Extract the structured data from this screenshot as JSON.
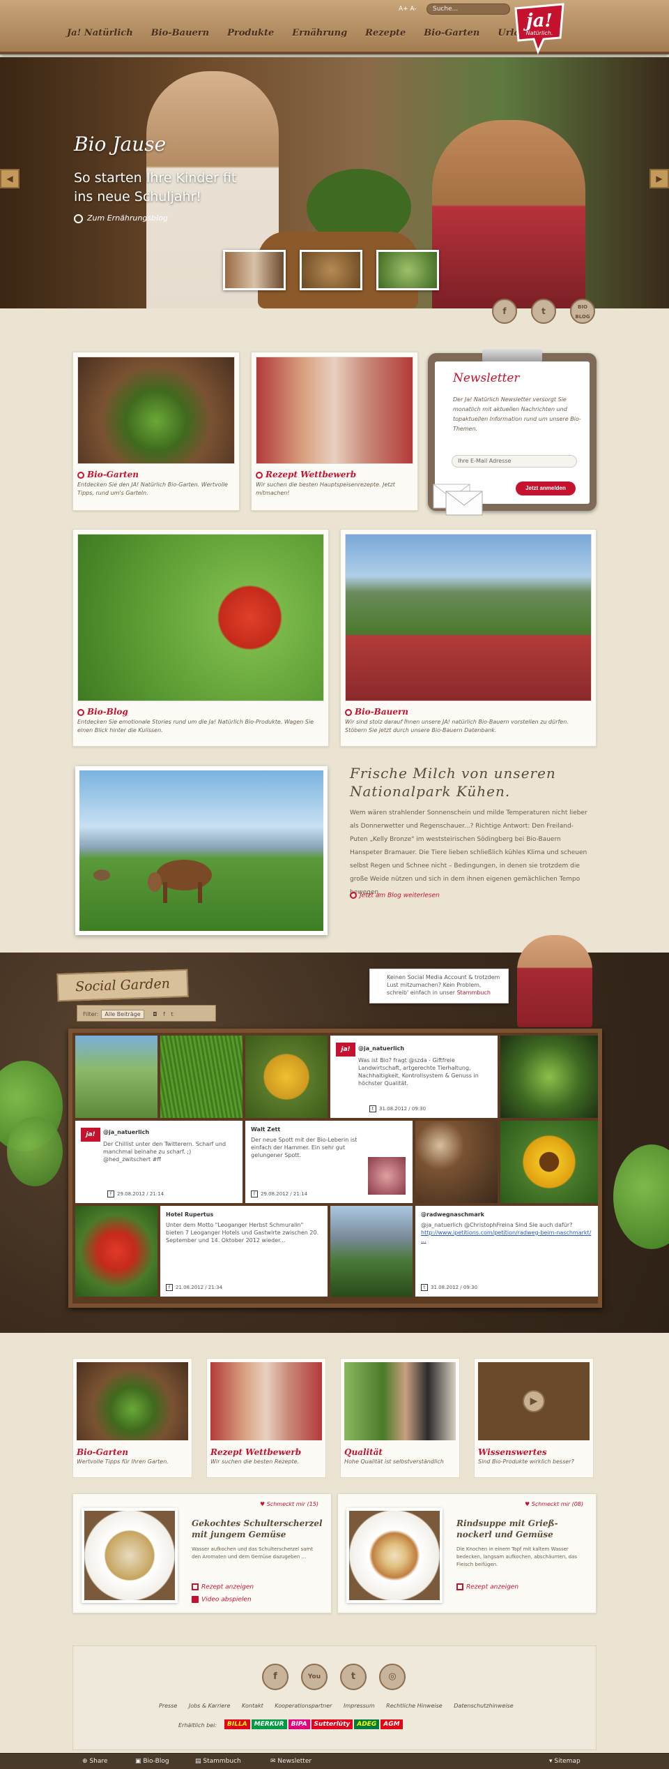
{
  "header": {
    "font_size": "A+ A-",
    "search_placeholder": "Suche...",
    "nav": [
      "Ja! Natürlich",
      "Bio-Bauern",
      "Produkte",
      "Ernährung",
      "Rezepte",
      "Bio-Garten",
      "Urlaub"
    ],
    "logo_text": "ja!",
    "logo_sub": "Natürlich."
  },
  "hero": {
    "title": "Bio Jause",
    "subtitle": "So starten Ihre Kinder fit ins neue Schuljahr!",
    "link": "Zum Ernährungsblog",
    "prev": "◀",
    "next": "▶",
    "social": [
      "f",
      "t",
      "BIO\nBLOG"
    ]
  },
  "cards": {
    "garten": {
      "title": "Bio-Garten",
      "text": "Entdecken Sie den JA! Natürlich Bio-Garten. Wertvolle Tipps, rund um's Garteln."
    },
    "rezept": {
      "title": "Rezept Wettbewerb",
      "text": "Wir suchen die besten Hauptspeisenrezepte. Jetzt mitmachen!"
    },
    "blog": {
      "title": "Bio-Blog",
      "text": "Entdecken Sie emotionale Stories rund um die Ja! Natürlich Bio-Produkte. Wagen Sie einen Blick hinter die Kulissen."
    },
    "bauern": {
      "title": "Bio-Bauern",
      "text": "Wir sind stolz darauf Ihnen unsere JA! natürlich Bio-Bauern vorstellen zu dürfen. Stöbern Sie jetzt durch unsere Bio-Bauern Datenbank."
    }
  },
  "newsletter": {
    "title": "Newsletter",
    "text": "Der Ja! Natürlich Newsletter versorgt Sie monatlich mit aktuellen Nachrichten und topaktuellen Information rund um unsere Bio-Themen.",
    "placeholder": "Ihre E-Mail Adresse",
    "button": "Jetzt anmelden"
  },
  "article": {
    "title": "Frische Milch von unseren Nationalpark Kühen.",
    "text": "Wem wären strahlender Sonnenschein und milde Temperaturen nicht lieber als Donnerwetter und Regenschauer...? Richtige Antwort: Den Freiland-Puten „Kelly Bronze\" im weststeirischen Södingberg bei Bio-Bauern Hanspeter Bramauer. Die Tiere lieben schließlich kühles Klima und scheuen selbst Regen und Schnee nicht – Bedingungen, in denen sie trotzdem die große Weide nützen und sich in dem ihnen eigenen gemächlichen Tempo bewegen.",
    "more": "Jetzt am Blog weiterlesen"
  },
  "social_garden": {
    "title": "Social Garden",
    "filter_label": "Filter:",
    "filter_value": "Alle Beiträge",
    "note": "Keinen Social Media Account & trotzdem Lust mitzumachen? Kein Problem, schreib' einfach in unser",
    "note_link": "Stammbuch",
    "posts": [
      {
        "user": "@ja_natuerlich",
        "text": "Was ist Bio? fragt @szda - Giftfreie Landwirtschaft, artgerechte Tierhaltung, Nachhaltigkeit, Kontrollsystem & Genuss in höchster Qualität.",
        "date": "31.08.2012 / 09:30"
      },
      {
        "user": "@ja_natuerlich",
        "text": "Der Chillist unter den Twitterern. Scharf und manchmal beinahe zu scharf. ;) @hed_zwitschert #ff",
        "date": "29.08.2012 / 21:14"
      },
      {
        "user": "Walt Zett",
        "text": "Der neue Spott mit der Bio-Leberin ist einfach der Hammer. Ein sehr gut gelungener Spott.",
        "date": "29.08.2012 / 21:14"
      },
      {
        "user": "Hotel Rupertus",
        "text": "Unter dem Motto \"Leoganger Herbst Schmuralin\" bieten 7 Leoganger Hotels und Gastwirte zwischen 20. September und 14. Oktober 2012 wieder...",
        "date": "21.08.2012 / 21:34"
      },
      {
        "user": "@radwegnaschmark",
        "text": "@ja_natuerlich @ChristophFreina Sind Sie auch dafür?",
        "link": "http://www.ipetitions.com/petition/radweg-beim-naschmarkt/ ...",
        "date": "31.08.2012 / 09:30"
      }
    ]
  },
  "bottom_cards": [
    {
      "title": "Bio-Garten",
      "text": "Wertvolle Tipps für Ihren Garten."
    },
    {
      "title": "Rezept Wettbewerb",
      "text": "Wir suchen die besten Rezepte."
    },
    {
      "title": "Qualität",
      "text": "Hohe Qualität ist selbstverständlich"
    },
    {
      "title": "Wissenswertes",
      "text": "Sind Bio-Produkte wirklich besser?"
    }
  ],
  "recipes": [
    {
      "likes": "Schmeckt mir (15)",
      "title": "Gekochtes Schulterscherzel mit jungem Gemüse",
      "text": "Wasser aufkochen und das Schulterscherzel samt den Aromaten und dem Gemüse dazugeben ...",
      "action1": "Rezept anzeigen",
      "action2": "Video abspielen"
    },
    {
      "likes": "Schmeckt mir (08)",
      "title": "Rindsuppe mit Grieß-nockerl und Gemüse",
      "text": "Die Knochen in einem Topf mit kaltem Wasser bedecken, langsam aufkochen, abschäumen, das Fleisch beifügen.",
      "action1": "Rezept anzeigen"
    }
  ],
  "footer": {
    "icons": [
      "f",
      "You",
      "t",
      "◎"
    ],
    "links": [
      "Presse",
      "Jobs & Karriere",
      "Kontakt",
      "Kooperationspartner",
      "Impressum",
      "Rechtliche Hinweise",
      "Datenschutzhinweise"
    ],
    "sold_at": "Erhältlich bei:",
    "brands": [
      "BILLA",
      "MERKUR",
      "BIPA",
      "Sutterlüty",
      "ADEG",
      "AGM"
    ],
    "brand_colors": [
      "#e3001b",
      "#009a44",
      "#e4007d",
      "#e2001a",
      "#007a3d",
      "#e30613"
    ]
  },
  "bottombar": {
    "share": "Share",
    "blog": "Bio-Blog",
    "stamm": "Stammbuch",
    "news": "Newsletter",
    "sitemap": "Sitemap"
  }
}
